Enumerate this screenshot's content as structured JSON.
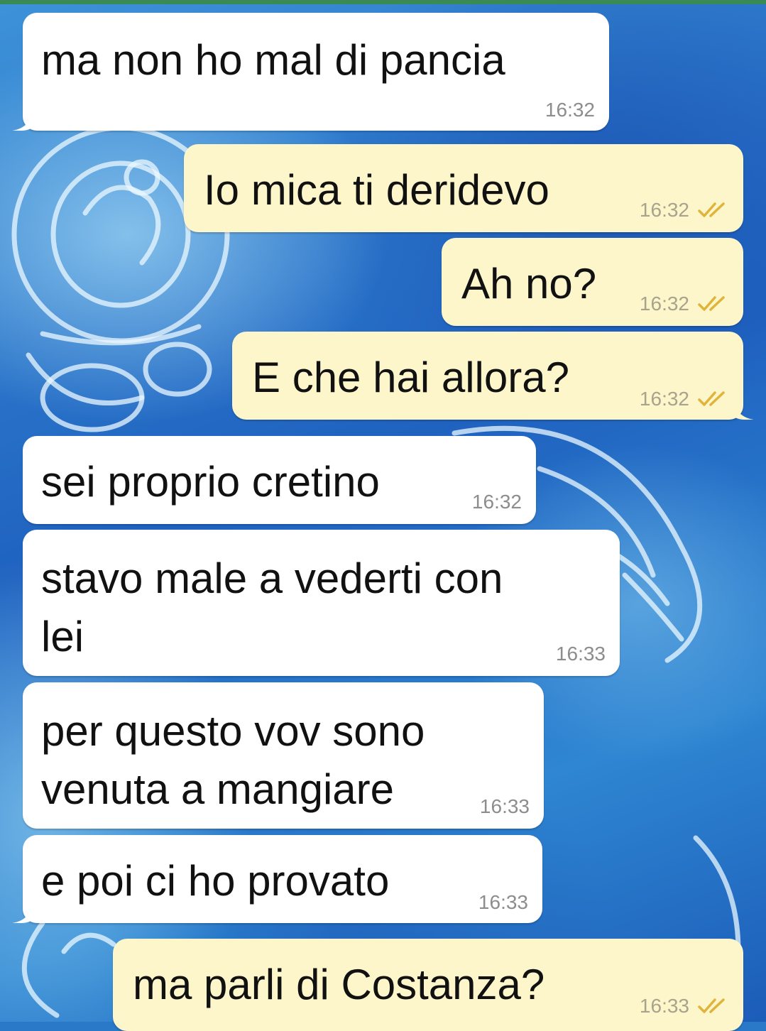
{
  "messages": [
    {
      "direction": "incoming",
      "text": "ma non ho mal di pancia",
      "time": "16:32",
      "status": ""
    },
    {
      "direction": "outgoing",
      "text": "Io mica ti deridevo",
      "time": "16:32",
      "status": "read-icon"
    },
    {
      "direction": "outgoing",
      "text": "Ah no?",
      "time": "16:32",
      "status": "read-icon"
    },
    {
      "direction": "outgoing",
      "text": "E che hai allora?",
      "time": "16:32",
      "status": "read-icon"
    },
    {
      "direction": "incoming",
      "text": "sei proprio cretino",
      "time": "16:32",
      "status": ""
    },
    {
      "direction": "incoming",
      "text": "stavo male a vederti con\nlei",
      "time": "16:33",
      "status": ""
    },
    {
      "direction": "incoming",
      "text": "per questo vov sono\nvenuta a mangiare",
      "time": "16:33",
      "status": ""
    },
    {
      "direction": "incoming",
      "text": "e poi ci ho provato",
      "time": "16:33",
      "status": ""
    },
    {
      "direction": "outgoing",
      "text": "ma parli di Costanza?",
      "time": "16:33",
      "status": "read-icon"
    }
  ],
  "colors": {
    "incoming_bubble": "#ffffff",
    "outgoing_bubble": "#fdf6cb",
    "read_check": "#e0b43a",
    "top_strip": "#3a8a55"
  }
}
